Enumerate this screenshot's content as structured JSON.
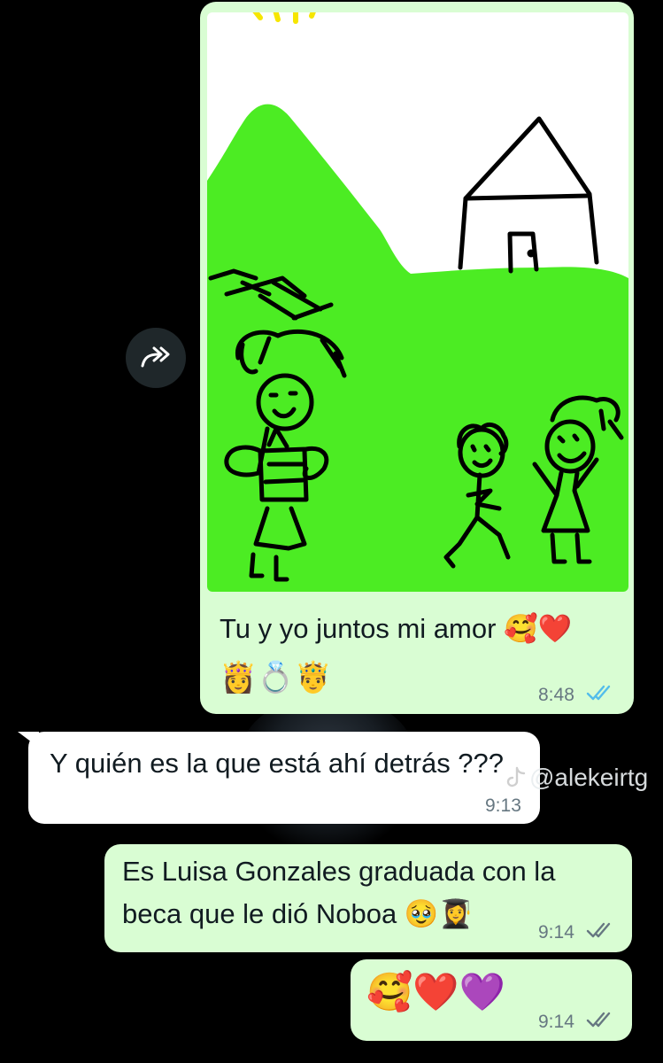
{
  "messages": [
    {
      "id": "drawing-message",
      "direction": "outgoing",
      "caption_text": "Tu y yo juntos mi amor",
      "caption_emojis": "🥰❤️",
      "caption_line2": "👸💍🤴",
      "time": "8:48",
      "status": "read"
    },
    {
      "id": "question-message",
      "direction": "incoming",
      "text": "Y quién es la que está ahí detrás ???",
      "time": "9:13"
    },
    {
      "id": "reply-message",
      "direction": "outgoing",
      "line1": "Es Luisa Gonzales graduada con la",
      "line2": "beca que le dió Noboa",
      "line2_emojis": "🥹👩‍🎓",
      "time": "9:14",
      "status": "delivered"
    },
    {
      "id": "emoji-message",
      "direction": "outgoing",
      "text": "🥰❤️💜",
      "time": "9:14",
      "status": "delivered"
    }
  ],
  "watermark": {
    "handle": "@alekeirtg",
    "icon": "tiktok-icon"
  },
  "colors": {
    "outgoing_bubble": "#d9fdd3",
    "incoming_bubble": "#ffffff",
    "grass": "#4cec23",
    "read_tick": "#53bdeb",
    "delivered_tick": "#667781"
  }
}
